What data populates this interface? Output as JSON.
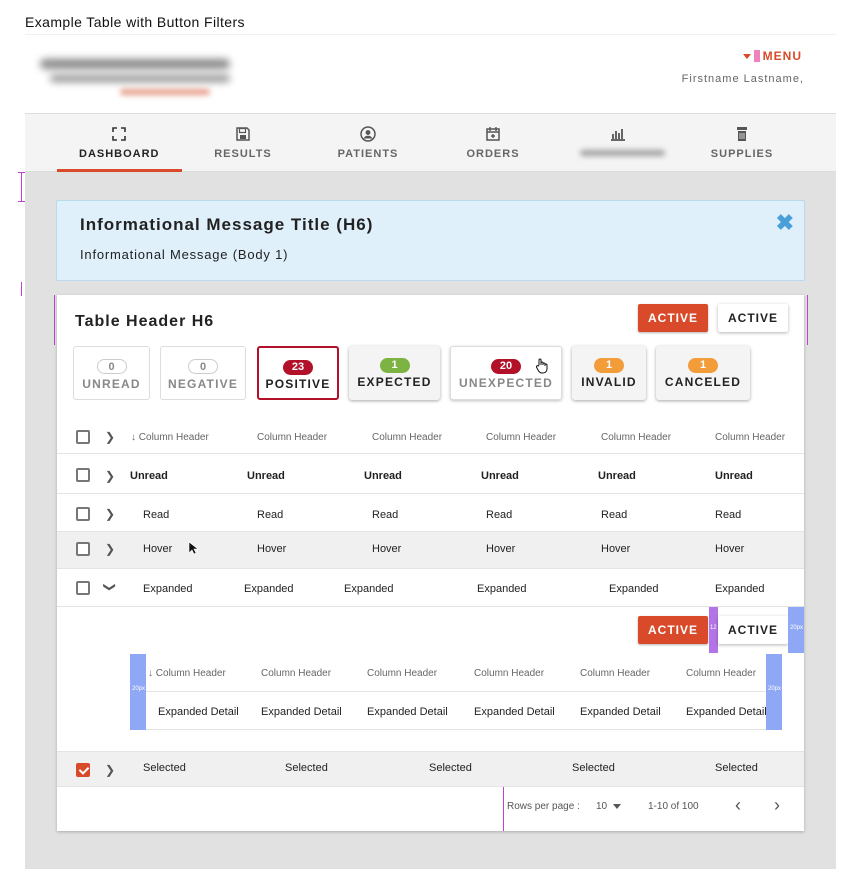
{
  "page_title": "Example Table with Button Filters",
  "header": {
    "menu_label": "MENU",
    "user_name": "Firstname Lastname,"
  },
  "nav": {
    "items": [
      {
        "label": "DASHBOARD",
        "icon": "expand-icon",
        "active": true
      },
      {
        "label": "RESULTS",
        "icon": "save-icon",
        "active": false
      },
      {
        "label": "PATIENTS",
        "icon": "user-circle-icon",
        "active": false
      },
      {
        "label": "ORDERS",
        "icon": "calendar-plus-icon",
        "active": false
      },
      {
        "label": "",
        "icon": "bar-chart-icon",
        "active": false
      },
      {
        "label": "SUPPLIES",
        "icon": "trash-can-icon",
        "active": false
      }
    ]
  },
  "info": {
    "title": "Informational Message Title (H6)",
    "body": "Informational Message (Body 1)",
    "close_icon": "close-x-icon"
  },
  "table": {
    "title": "Table Header H6",
    "active_red_label": "ACTIVE",
    "active_white_label": "ACTIVE",
    "filters": [
      {
        "count": "0",
        "label": "UNREAD",
        "style": "flat"
      },
      {
        "count": "0",
        "label": "NEGATIVE",
        "style": "flat"
      },
      {
        "count": "23",
        "label": "POSITIVE",
        "style": "selected"
      },
      {
        "count": "1",
        "label": "EXPECTED",
        "style": "raised"
      },
      {
        "count": "20",
        "label": "UNEXPECTED",
        "style": "flat"
      },
      {
        "count": "1",
        "label": "INVALID",
        "style": "raised"
      },
      {
        "count": "1",
        "label": "CANCELED",
        "style": "raised"
      }
    ],
    "columns": [
      "Column Header",
      "Column Header",
      "Column Header",
      "Column Header",
      "Column Header",
      "Column Header"
    ],
    "rows": [
      {
        "state": "unread",
        "cells": [
          "Unread",
          "Unread",
          "Unread",
          "Unread",
          "Unread",
          "Unread"
        ]
      },
      {
        "state": "read",
        "cells": [
          "Read",
          "Read",
          "Read",
          "Read",
          "Read",
          "Read"
        ]
      },
      {
        "state": "hover",
        "cells": [
          "Hover",
          "Hover",
          "Hover",
          "Hover",
          "Hover",
          "Hover"
        ]
      },
      {
        "state": "expanded",
        "cells": [
          "Expanded",
          "Expanded",
          "Expanded",
          "Expanded",
          "Expanded",
          "Expanded"
        ]
      }
    ],
    "detail": {
      "active_red_label": "ACTIVE",
      "active_white_label": "ACTIVE",
      "columns": [
        "Column Header",
        "Column Header",
        "Column Header",
        "Column Header",
        "Column Header",
        "Column Header"
      ],
      "cells": [
        "Expanded Detail",
        "Expanded Detail",
        "Expanded Detail",
        "Expanded Detail",
        "Expanded Detail",
        "Expanded Detail"
      ],
      "spacer_label": "20px",
      "spacer_label_small": "12"
    },
    "selected_row": {
      "cells": [
        "Selected",
        "Selected",
        "Selected",
        "Selected",
        "Selected"
      ]
    },
    "pagination": {
      "rows_per_page_label": "Rows per page :",
      "rows_per_page_value": "10",
      "range": "1-10 of 100"
    }
  },
  "colors": {
    "accent": "#d94a2a",
    "positive": "#b3102a",
    "expected": "#7cb342",
    "warning": "#f39c3a",
    "info_bg": "#dff0fb",
    "info_close": "#4a9fd8",
    "spacer_blue": "#8fa8f5",
    "spacer_purple": "#b274e6"
  }
}
